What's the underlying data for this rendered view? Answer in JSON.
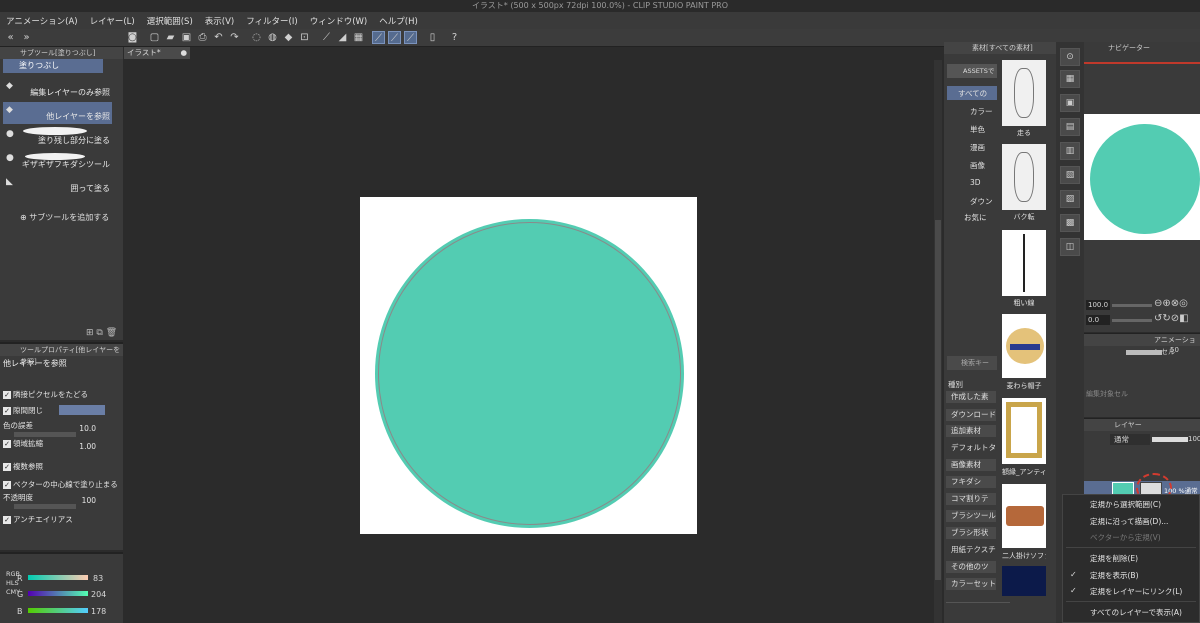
{
  "window": {
    "title": "イラスト* (500 x 500px 72dpi 100.0%) - CLIP STUDIO PAINT PRO"
  },
  "menu": [
    "アニメーション(A)",
    "レイヤー(L)",
    "選択範囲(S)",
    "表示(V)",
    "フィルター(I)",
    "ウィンドウ(W)",
    "ヘルプ(H)"
  ],
  "subtool_panel": {
    "header": "サブツール[塗りつぶし]",
    "group": "塗りつぶし",
    "items": [
      "編集レイヤーのみ参照",
      "他レイヤーを参照",
      "塗り残し部分に塗る",
      "ギザギザフキダシツール",
      "囲って塗る"
    ],
    "add_label": "サブツールを追加する"
  },
  "tool_property": {
    "header": "ツールプロパティ[他レイヤーを参照]",
    "tool_name": "他レイヤーを参照",
    "rows": {
      "adjacent": "隣接ピクセルをたどる",
      "gap": "隙間閉じ",
      "color_margin": "色の誤差",
      "color_margin_val": "10.0",
      "area_scale": "領域拡縮",
      "area_scale_val": "1.00",
      "multi_ref": "複数参照",
      "vector_center": "ベクターの中心線で塗り止まる",
      "opacity": "不透明度",
      "opacity_val": "100",
      "antialias": "アンチエイリアス"
    }
  },
  "color_panel": {
    "tabs": [
      "RGB",
      "HLS",
      "CMY"
    ],
    "r_label": "R",
    "r_val": "83",
    "g_label": "G",
    "g_val": "204",
    "b_label": "B",
    "b_val": "178",
    "fill_color": "#53CCB2"
  },
  "canvas": {
    "tab_label": "イラスト*",
    "circle_color": "#53CCB2"
  },
  "material_panel": {
    "header": "素材[すべての素材]",
    "assets_label": "ASSETSで",
    "tree": [
      "すべての",
      "カラー",
      "単色",
      "漫画",
      "画像",
      "3D",
      "ダウン",
      "お気に"
    ],
    "search_placeholder": "検索キー",
    "category_label": "種別",
    "buttons": [
      "作成した素",
      "ダウンロード",
      "追加素材",
      "デフォルトタ",
      "画像素材",
      "フキダシ",
      "コマ割りテ",
      "ブラシツール",
      "ブラシ形状",
      "用紙テクスチ",
      "その他のツ",
      "カラーセット"
    ],
    "thumbs": [
      "走る",
      "バク転",
      "粗い線",
      "麦わら帽子",
      "額縁_アンティ",
      "二人掛けソファ",
      ""
    ]
  },
  "navigator": {
    "header": "ナビゲーター",
    "zoom": "100.0",
    "angle": "0.0"
  },
  "animation_cel": {
    "header": "アニメーションセル",
    "opacity": "50",
    "edit_target": "編集対象セル"
  },
  "layer_panel": {
    "header": "レイヤー",
    "blend": "通常",
    "opacity": "100",
    "layer_label": "100 %通常"
  },
  "context_menu": {
    "items": [
      "定規から選択範囲(C)",
      "定規に沿って描画(D)...",
      "ベクターから定規(V)",
      "定規を削除(E)",
      "定規を表示(B)",
      "定規をレイヤーにリンク(L)",
      "すべてのレイヤーで表示(A)"
    ],
    "checked": [
      "定規を表示(B)",
      "定規をレイヤーにリンク(L)"
    ]
  }
}
